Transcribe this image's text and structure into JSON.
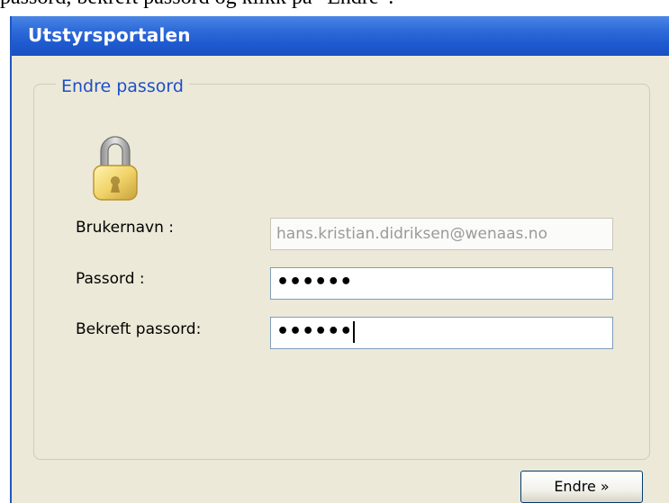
{
  "caption": "passord, bekreft passord og klikk på “Endre”.",
  "window": {
    "title": "Utstyrsportalen"
  },
  "form": {
    "legend": "Endre passord",
    "username_label": "Brukernavn :",
    "username_value": "hans.kristian.didriksen@wenaas.no",
    "password_label": "Passord :",
    "password_value": "••••••",
    "confirm_label": "Bekreft passord:",
    "confirm_value": "••••••"
  },
  "buttons": {
    "submit_label": "Endre »"
  },
  "icons": {
    "lock": "padlock-icon"
  },
  "colors": {
    "title_bar": "#2f6bd8",
    "background": "#ECE9D8",
    "legend_text": "#1d4fc7"
  }
}
